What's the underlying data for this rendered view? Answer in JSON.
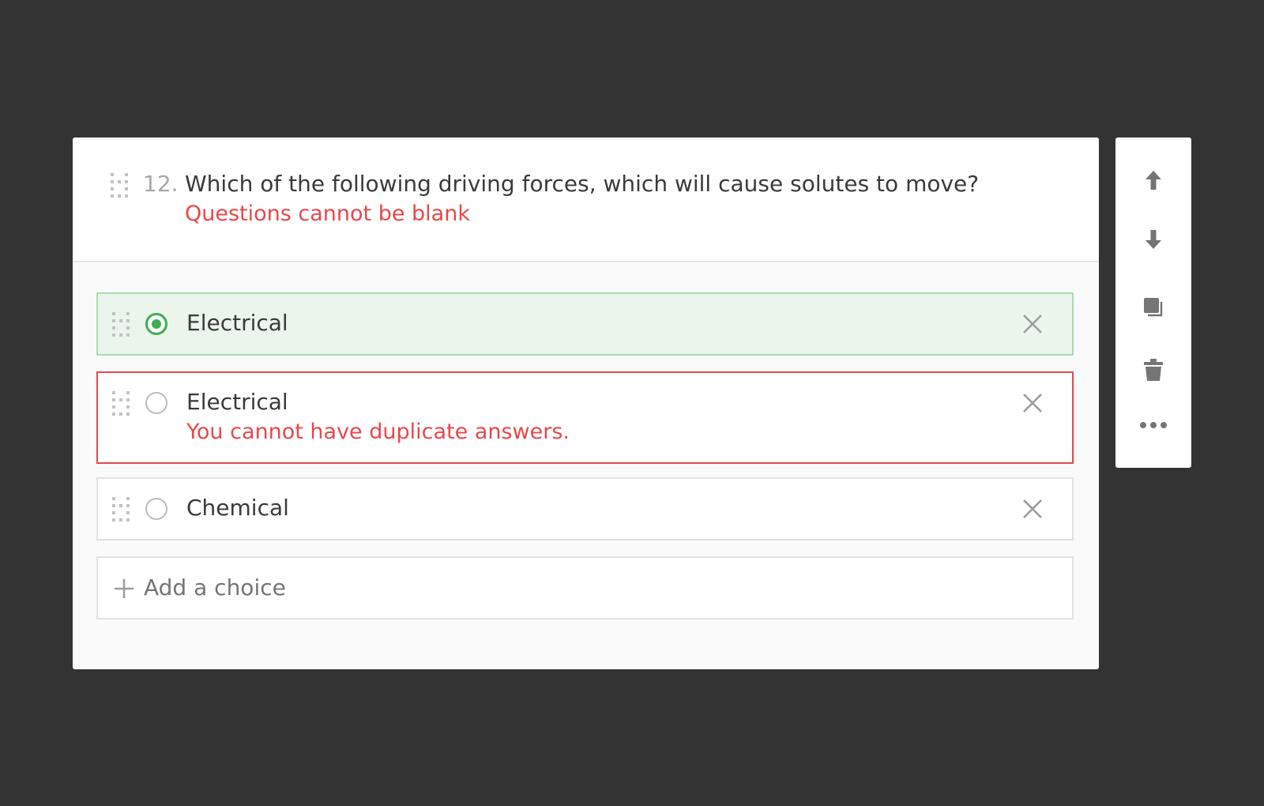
{
  "question": {
    "number": "12.",
    "text": "Which of the following driving forces, which will cause solutes to move?",
    "error": "Questions cannot be blank"
  },
  "choices": [
    {
      "label": "Electrical",
      "selected": true,
      "state": "correct",
      "error": ""
    },
    {
      "label": "Electrical",
      "selected": false,
      "state": "error",
      "error": "You cannot have duplicate answers."
    },
    {
      "label": "Chemical",
      "selected": false,
      "state": "normal",
      "error": ""
    }
  ],
  "add_choice": {
    "label": "Add a choice"
  },
  "toolbar": {
    "icons": [
      "arrow-up-icon",
      "arrow-down-icon",
      "duplicate-icon",
      "trash-icon",
      "more-icon"
    ]
  },
  "colors": {
    "background": "#333333",
    "error": "#e8484a",
    "correct": "#3dae53",
    "correct_fill": "#ebf5ec",
    "correct_border": "#a9dcb1",
    "icon": "#757575"
  }
}
